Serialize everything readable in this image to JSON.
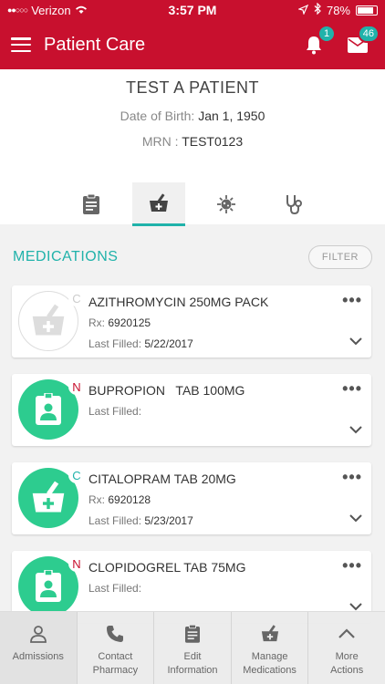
{
  "status": {
    "carrier": "Verizon",
    "time": "3:57 PM",
    "battery": "78%"
  },
  "header": {
    "title": "Patient Care",
    "notifications_count": "1",
    "messages_count": "46"
  },
  "patient": {
    "name": "TEST A PATIENT",
    "dob_label": "Date of Birth:",
    "dob_value": "Jan 1, 1950",
    "mrn_label": "MRN :",
    "mrn_value": "TEST0123"
  },
  "section": {
    "title": "MEDICATIONS",
    "filter_label": "FILTER"
  },
  "medications": [
    {
      "letter": "C",
      "name": "AZITHROMYCIN 250MG PACK",
      "rx_label": "Rx:",
      "rx": "6920125",
      "last_filled_label": "Last Filled:",
      "last_filled": "5/22/2017"
    },
    {
      "letter": "N",
      "name": "BUPROPION   TAB 100MG",
      "last_filled_label": "Last Filled:",
      "last_filled": ""
    },
    {
      "letter": "C",
      "name": "CITALOPRAM TAB 20MG",
      "rx_label": "Rx:",
      "rx": "6920128",
      "last_filled_label": "Last Filled:",
      "last_filled": "5/23/2017"
    },
    {
      "letter": "N",
      "name": "CLOPIDOGREL TAB 75MG",
      "last_filled_label": "Last Filled:",
      "last_filled": ""
    }
  ],
  "bottom_nav": [
    {
      "label": "Admissions"
    },
    {
      "label": "Contact\nPharmacy"
    },
    {
      "label": "Edit\nInformation"
    },
    {
      "label": "Manage\nMedications"
    },
    {
      "label": "More\nActions"
    }
  ],
  "colors": {
    "brand": "#c8102e",
    "accent": "#20b2aa",
    "med_green": "#2dcc8f",
    "letter_c": "#20b2aa",
    "letter_n": "#c8102e"
  }
}
